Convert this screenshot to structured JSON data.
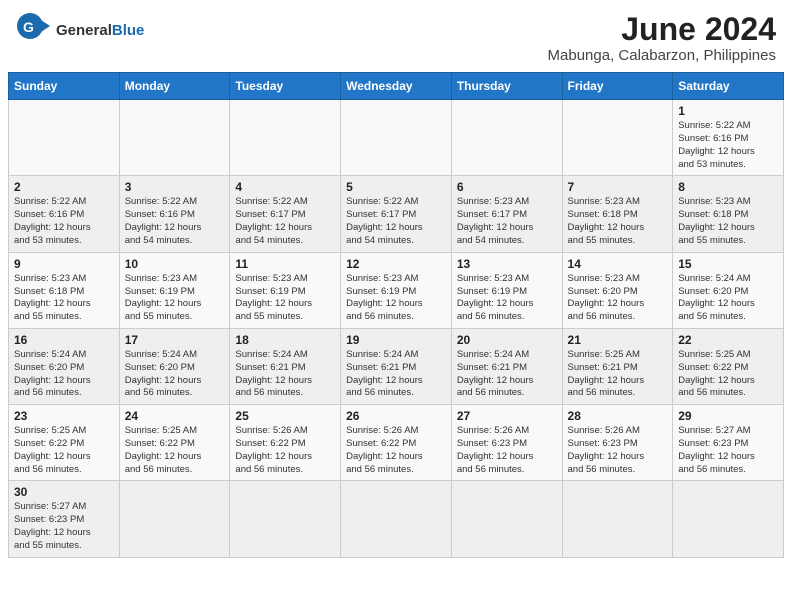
{
  "header": {
    "title": "June 2024",
    "subtitle": "Mabunga, Calabarzon, Philippines",
    "logo_general": "General",
    "logo_blue": "Blue"
  },
  "calendar": {
    "days_of_week": [
      "Sunday",
      "Monday",
      "Tuesday",
      "Wednesday",
      "Thursday",
      "Friday",
      "Saturday"
    ],
    "weeks": [
      [
        {
          "day": "",
          "info": ""
        },
        {
          "day": "",
          "info": ""
        },
        {
          "day": "",
          "info": ""
        },
        {
          "day": "",
          "info": ""
        },
        {
          "day": "",
          "info": ""
        },
        {
          "day": "",
          "info": ""
        },
        {
          "day": "1",
          "info": "Sunrise: 5:22 AM\nSunset: 6:16 PM\nDaylight: 12 hours\nand 53 minutes."
        }
      ],
      [
        {
          "day": "2",
          "info": "Sunrise: 5:22 AM\nSunset: 6:16 PM\nDaylight: 12 hours\nand 53 minutes."
        },
        {
          "day": "3",
          "info": "Sunrise: 5:22 AM\nSunset: 6:16 PM\nDaylight: 12 hours\nand 54 minutes."
        },
        {
          "day": "4",
          "info": "Sunrise: 5:22 AM\nSunset: 6:17 PM\nDaylight: 12 hours\nand 54 minutes."
        },
        {
          "day": "5",
          "info": "Sunrise: 5:22 AM\nSunset: 6:17 PM\nDaylight: 12 hours\nand 54 minutes."
        },
        {
          "day": "6",
          "info": "Sunrise: 5:23 AM\nSunset: 6:17 PM\nDaylight: 12 hours\nand 54 minutes."
        },
        {
          "day": "7",
          "info": "Sunrise: 5:23 AM\nSunset: 6:18 PM\nDaylight: 12 hours\nand 55 minutes."
        },
        {
          "day": "8",
          "info": "Sunrise: 5:23 AM\nSunset: 6:18 PM\nDaylight: 12 hours\nand 55 minutes."
        }
      ],
      [
        {
          "day": "9",
          "info": "Sunrise: 5:23 AM\nSunset: 6:18 PM\nDaylight: 12 hours\nand 55 minutes."
        },
        {
          "day": "10",
          "info": "Sunrise: 5:23 AM\nSunset: 6:19 PM\nDaylight: 12 hours\nand 55 minutes."
        },
        {
          "day": "11",
          "info": "Sunrise: 5:23 AM\nSunset: 6:19 PM\nDaylight: 12 hours\nand 55 minutes."
        },
        {
          "day": "12",
          "info": "Sunrise: 5:23 AM\nSunset: 6:19 PM\nDaylight: 12 hours\nand 56 minutes."
        },
        {
          "day": "13",
          "info": "Sunrise: 5:23 AM\nSunset: 6:19 PM\nDaylight: 12 hours\nand 56 minutes."
        },
        {
          "day": "14",
          "info": "Sunrise: 5:23 AM\nSunset: 6:20 PM\nDaylight: 12 hours\nand 56 minutes."
        },
        {
          "day": "15",
          "info": "Sunrise: 5:24 AM\nSunset: 6:20 PM\nDaylight: 12 hours\nand 56 minutes."
        }
      ],
      [
        {
          "day": "16",
          "info": "Sunrise: 5:24 AM\nSunset: 6:20 PM\nDaylight: 12 hours\nand 56 minutes."
        },
        {
          "day": "17",
          "info": "Sunrise: 5:24 AM\nSunset: 6:20 PM\nDaylight: 12 hours\nand 56 minutes."
        },
        {
          "day": "18",
          "info": "Sunrise: 5:24 AM\nSunset: 6:21 PM\nDaylight: 12 hours\nand 56 minutes."
        },
        {
          "day": "19",
          "info": "Sunrise: 5:24 AM\nSunset: 6:21 PM\nDaylight: 12 hours\nand 56 minutes."
        },
        {
          "day": "20",
          "info": "Sunrise: 5:24 AM\nSunset: 6:21 PM\nDaylight: 12 hours\nand 56 minutes."
        },
        {
          "day": "21",
          "info": "Sunrise: 5:25 AM\nSunset: 6:21 PM\nDaylight: 12 hours\nand 56 minutes."
        },
        {
          "day": "22",
          "info": "Sunrise: 5:25 AM\nSunset: 6:22 PM\nDaylight: 12 hours\nand 56 minutes."
        }
      ],
      [
        {
          "day": "23",
          "info": "Sunrise: 5:25 AM\nSunset: 6:22 PM\nDaylight: 12 hours\nand 56 minutes."
        },
        {
          "day": "24",
          "info": "Sunrise: 5:25 AM\nSunset: 6:22 PM\nDaylight: 12 hours\nand 56 minutes."
        },
        {
          "day": "25",
          "info": "Sunrise: 5:26 AM\nSunset: 6:22 PM\nDaylight: 12 hours\nand 56 minutes."
        },
        {
          "day": "26",
          "info": "Sunrise: 5:26 AM\nSunset: 6:22 PM\nDaylight: 12 hours\nand 56 minutes."
        },
        {
          "day": "27",
          "info": "Sunrise: 5:26 AM\nSunset: 6:23 PM\nDaylight: 12 hours\nand 56 minutes."
        },
        {
          "day": "28",
          "info": "Sunrise: 5:26 AM\nSunset: 6:23 PM\nDaylight: 12 hours\nand 56 minutes."
        },
        {
          "day": "29",
          "info": "Sunrise: 5:27 AM\nSunset: 6:23 PM\nDaylight: 12 hours\nand 56 minutes."
        }
      ],
      [
        {
          "day": "30",
          "info": "Sunrise: 5:27 AM\nSunset: 6:23 PM\nDaylight: 12 hours\nand 55 minutes."
        },
        {
          "day": "",
          "info": ""
        },
        {
          "day": "",
          "info": ""
        },
        {
          "day": "",
          "info": ""
        },
        {
          "day": "",
          "info": ""
        },
        {
          "day": "",
          "info": ""
        },
        {
          "day": "",
          "info": ""
        }
      ]
    ]
  }
}
